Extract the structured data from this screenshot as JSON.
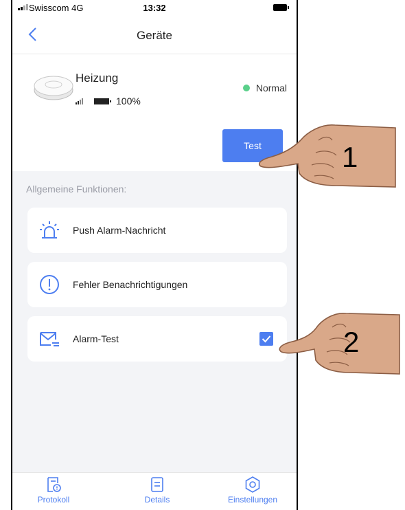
{
  "status_bar": {
    "carrier": "Swisscom 4G",
    "time": "13:32"
  },
  "nav": {
    "title": "Geräte",
    "back_icon": "chevron-left-icon"
  },
  "device": {
    "name": "Heizung",
    "battery_percent": "100%",
    "status": "Normal",
    "status_color": "#5ad08a",
    "test_button": "Test"
  },
  "section_title": "Allgemeine Funktionen:",
  "functions": [
    {
      "label": "Push Alarm-Nachricht",
      "icon": "siren-icon"
    },
    {
      "label": "Fehler Benachrichtigungen",
      "icon": "warning-icon"
    },
    {
      "label": "Alarm-Test",
      "icon": "mail-icon",
      "checked": true
    }
  ],
  "tabs": [
    {
      "label": "Protokoll",
      "icon": "log-icon"
    },
    {
      "label": "Details",
      "icon": "details-icon"
    },
    {
      "label": "Einstellungen",
      "icon": "gear-icon"
    }
  ],
  "annotations": {
    "first": "1",
    "second": "2"
  },
  "accent_color": "#4d7ef0"
}
